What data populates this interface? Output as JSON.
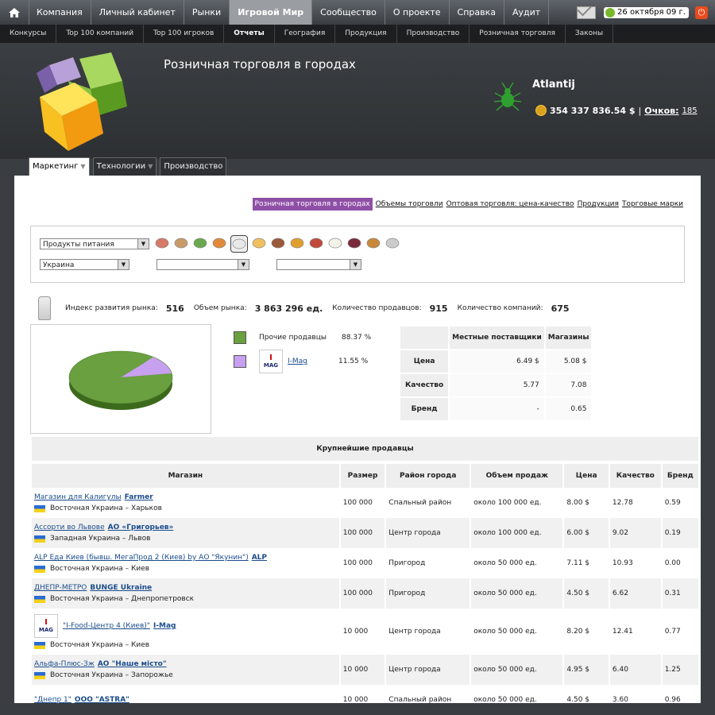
{
  "topnav": {
    "items": [
      "Компания",
      "Личный кабинет",
      "Рынки",
      "Игровой Мир",
      "Сообщество",
      "О проекте",
      "Справка",
      "Аудит"
    ],
    "active_index": 3,
    "date": "26 октября 09 г."
  },
  "subnav": {
    "items": [
      "Конкурсы",
      "Top 100 компаний",
      "Top 100 игроков",
      "Отчеты",
      "География",
      "Продукция",
      "Производство",
      "Розничная торговля",
      "Законы"
    ],
    "active_index": 3
  },
  "header": {
    "title": "Розничная торговля в городах",
    "user": "Atlantij",
    "money": "354 337 836.54 $",
    "sep": "|",
    "points_label": "Очков:",
    "points_value": "185"
  },
  "tabs": [
    {
      "label": "Маркетинг",
      "arrow": true
    },
    {
      "label": "Технологии",
      "arrow": true
    },
    {
      "label": "Производство",
      "arrow": false
    }
  ],
  "report_tabs": [
    "Розничная торговля в городах",
    "Объемы торговли",
    "Оптовая торговля: цена-качество",
    "Продукция",
    "Торговые марки"
  ],
  "filters": {
    "category": "Продукты питания",
    "country": "Украина",
    "region": "",
    "city": ""
  },
  "products": [
    {
      "name": "sausage-icon",
      "color": "#d67a6a"
    },
    {
      "name": "cake-icon",
      "color": "#c99a6a"
    },
    {
      "name": "canned-food-icon",
      "color": "#6aa84f"
    },
    {
      "name": "candy-icon",
      "color": "#e08a3a"
    },
    {
      "name": "milk-icon",
      "color": "#e8e8e8"
    },
    {
      "name": "yogurt-icon",
      "color": "#f0c060"
    },
    {
      "name": "ice-cream-icon",
      "color": "#9a5a3a"
    },
    {
      "name": "juice-icon",
      "color": "#e0a030"
    },
    {
      "name": "meat-icon",
      "color": "#c04a3a"
    },
    {
      "name": "cheese-icon",
      "color": "#f2f2e8"
    },
    {
      "name": "berries-icon",
      "color": "#7a2a3a"
    },
    {
      "name": "bread-icon",
      "color": "#c8883a"
    },
    {
      "name": "eggs-icon",
      "color": "#cccccc"
    }
  ],
  "stats": {
    "index_label": "Индекс развития рынка:",
    "index_value": "516",
    "volume_label": "Объем рынка:",
    "volume_value": "3 863 296 ед.",
    "sellers_label": "Количество продавцов:",
    "sellers_value": "915",
    "companies_label": "Количество компаний:",
    "companies_value": "675"
  },
  "chart_data": {
    "type": "pie",
    "slices": [
      {
        "name": "Прочие продавцы",
        "value": 88.37,
        "color": "#6aa040"
      },
      {
        "name": "I-Mag",
        "value": 11.55,
        "color": "#c8a0f0"
      }
    ]
  },
  "legend": [
    {
      "name": "Прочие продавцы",
      "pct": "88.37 %",
      "link": false
    },
    {
      "name": "I-Mag",
      "pct": "11.55 %",
      "link": true
    }
  ],
  "price_table": {
    "headers": [
      "",
      "Местные поставщики",
      "Магазины"
    ],
    "rows": [
      {
        "label": "Цена",
        "local": "6.49 $",
        "shops": "5.08 $"
      },
      {
        "label": "Качество",
        "local": "5.77",
        "shops": "7.08"
      },
      {
        "label": "Бренд",
        "local": "-",
        "shops": "0.65"
      }
    ]
  },
  "sellers": {
    "caption": "Крупнейшие продавцы",
    "headers": [
      "Магазин",
      "Размер",
      "Район города",
      "Объем продаж",
      "Цена",
      "Качество",
      "Бренд"
    ],
    "rows": [
      {
        "shop": "Магазин для Калигулы",
        "company": "Farmer",
        "region": "Восточная Украина – Харьков",
        "size": "100 000",
        "district": "Спальный район",
        "volume": "около 100 000 ед.",
        "price": "8.00 $",
        "quality": "12.78",
        "brand": "0.59",
        "logo": false
      },
      {
        "shop": "Ассорти во Львове",
        "company": "АО «Григорьев»",
        "region": "Западная Украина – Львов",
        "size": "100 000",
        "district": "Центр города",
        "volume": "около 100 000 ед.",
        "price": "6.00 $",
        "quality": "9.02",
        "brand": "0.19",
        "logo": false
      },
      {
        "shop": "ALP Еда Киев (бывш. МегаПрод 2 (Киев) by АО \"Якунин\")",
        "company": "ALP",
        "region": "Восточная Украина – Киев",
        "size": "100 000",
        "district": "Пригород",
        "volume": "около 50 000 ед.",
        "price": "7.11 $",
        "quality": "10.93",
        "brand": "0.00",
        "logo": false
      },
      {
        "shop": "ДНЕПР-МЕТРО",
        "company": "BUNGE Ukraine",
        "region": "Восточная Украина – Днепропетровск",
        "size": "100 000",
        "district": "Пригород",
        "volume": "около 50 000 ед.",
        "price": "4.50 $",
        "quality": "6.62",
        "brand": "0.31",
        "logo": false
      },
      {
        "shop": "\"I-Food-Центр 4 (Киев)\"",
        "company": "I-Mag",
        "region": "Восточная Украина – Киев",
        "size": "10 000",
        "district": "Центр города",
        "volume": "около 50 000 ед.",
        "price": "8.20 $",
        "quality": "12.41",
        "brand": "0.77",
        "logo": true
      },
      {
        "shop": "Альфа-Плюс-Зж",
        "company": "АО \"Наше місто\"",
        "region": "Восточная Украина – Запорожье",
        "size": "10 000",
        "district": "Центр города",
        "volume": "около 50 000 ед.",
        "price": "4.95 $",
        "quality": "6.40",
        "brand": "1.25",
        "logo": false
      },
      {
        "shop": "\"Днепр 1\"",
        "company": "ООО \"ASTRA\"",
        "region": "",
        "size": "10 000",
        "district": "Спальный район",
        "volume": "около 50 000 ед.",
        "price": "4.50 $",
        "quality": "3.60",
        "brand": "0.96",
        "logo": false
      }
    ]
  },
  "imag_logo_text": {
    "top": "I",
    "bottom": "MAG"
  }
}
